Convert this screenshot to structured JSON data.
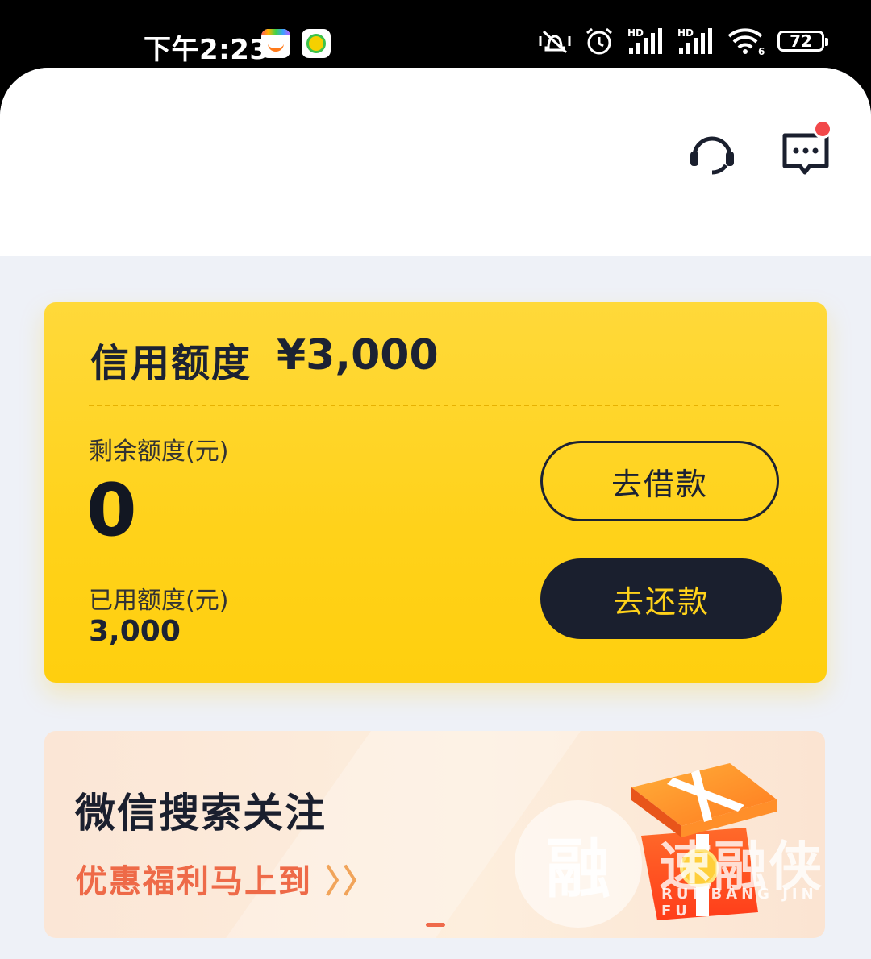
{
  "status_bar": {
    "time": "下午2:23",
    "battery": "72",
    "signal_labels": [
      "HD",
      "HD"
    ],
    "wifi_label": "6"
  },
  "header": {
    "icons": [
      "headset-icon",
      "message-icon"
    ]
  },
  "credit_card": {
    "title": "信用额度",
    "amount": "¥3,000",
    "remaining_label": "剩余额度(元)",
    "remaining_value": "0",
    "used_label": "已用额度(元)",
    "used_value": "3,000",
    "borrow_button": "去借款",
    "repay_button": "去还款",
    "colors": {
      "card": "#ffd21a",
      "dark": "#1a1f2e"
    }
  },
  "promo": {
    "title": "微信搜索关注",
    "subtitle": "优惠福利马上到",
    "arrows": "〉〉",
    "watermark_logo": "融",
    "watermark_text": "速融侠",
    "watermark_sub": "RUI BANG JIN FU"
  }
}
